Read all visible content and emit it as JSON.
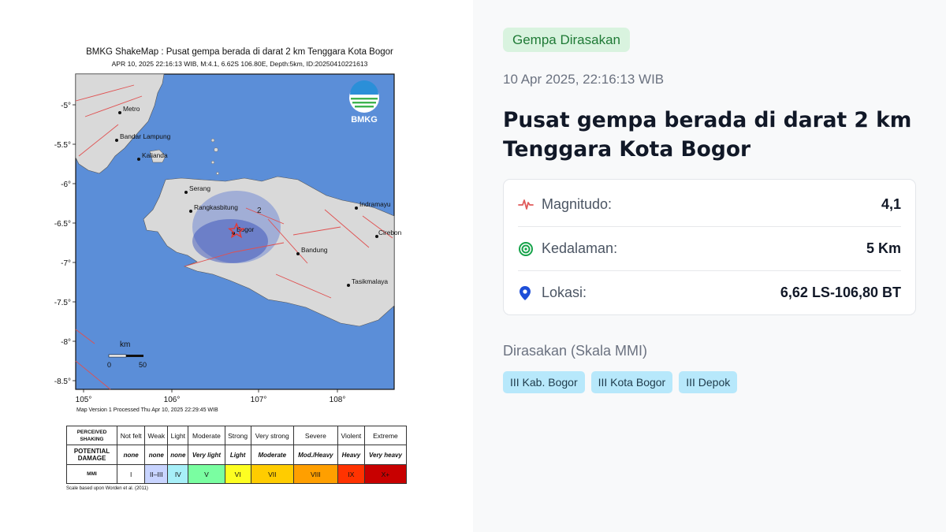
{
  "map": {
    "title": "BMKG ShakeMap : Pusat gempa berada di darat 2 km Tenggara Kota Bogor",
    "subtitle": "APR 10, 2025 22:16:13 WIB, M:4.1, 6.62S 106.80E, Depth:5km, ID:20250410221613",
    "logo_text": "BMKG",
    "y_ticks": [
      "-5°",
      "-5.5°",
      "-6°",
      "-6.5°",
      "-7°",
      "-7.5°",
      "-8°",
      "-8.5°"
    ],
    "x_ticks": [
      "105°",
      "106°",
      "107°",
      "108°"
    ],
    "cities": [
      "Metro",
      "Bandar Lampung",
      "Kalianda",
      "Serang",
      "Rangkasbitung",
      "Bogor",
      "Bandung",
      "Indramayu",
      "Cirebon",
      "Tasikmalaya"
    ],
    "intensity_label": "2",
    "scale_bar": {
      "unit": "km",
      "start": "0",
      "end": "50"
    },
    "version": "Map Version 1 Processed Thu Apr 10, 2025 22:29:45 WIB",
    "colors": {
      "sea": "#5b8ed8",
      "land": "#d9d9d9",
      "shaking": "#3a5fd0",
      "epicenter": "#e53935",
      "fault": "#e05050"
    }
  },
  "legend": {
    "row_headers": [
      "PERCEIVED SHAKING",
      "POTENTIAL DAMAGE",
      "MMI"
    ],
    "shaking": [
      "Not felt",
      "Weak",
      "Light",
      "Moderate",
      "Strong",
      "Very strong",
      "Severe",
      "Violent",
      "Extreme"
    ],
    "damage": [
      "none",
      "none",
      "none",
      "Very light",
      "Light",
      "Moderate",
      "Mod./Heavy",
      "Heavy",
      "Very heavy"
    ],
    "mmi": [
      "I",
      "II–III",
      "IV",
      "V",
      "VI",
      "VII",
      "VIII",
      "IX",
      "X+"
    ],
    "mmi_colors": [
      "#ffffff",
      "#c8d4ff",
      "#a7eff8",
      "#7afea1",
      "#fdfe22",
      "#ffcc00",
      "#ff9f00",
      "#ff3300",
      "#c80000"
    ],
    "credit": "Scale based upon Worden et al. (2011)"
  },
  "info": {
    "badge": "Gempa Dirasakan",
    "datetime": "10 Apr 2025, 22:16:13 WIB",
    "headline": "Pusat gempa berada di darat 2 km Tenggara Kota Bogor",
    "rows": [
      {
        "icon": "pulse-icon",
        "label": "Magnitudo:",
        "value": "4,1"
      },
      {
        "icon": "target-icon",
        "label": "Kedalaman:",
        "value": "5 Km"
      },
      {
        "icon": "map-pin-icon",
        "label": "Lokasi:",
        "value": "6,62 LS-106,80 BT"
      }
    ],
    "felt_title": "Dirasakan (Skala MMI)",
    "felt_chips": [
      "III Kab. Bogor",
      "III Kota Bogor",
      "III Depok"
    ],
    "colors": {
      "badge_bg": "#d9f3df",
      "badge_text": "#1f7a36",
      "chip_bg": "#b7e8fb",
      "pulse": "#e05a5a",
      "target": "#16a34a",
      "pin": "#1d4ed8"
    }
  }
}
